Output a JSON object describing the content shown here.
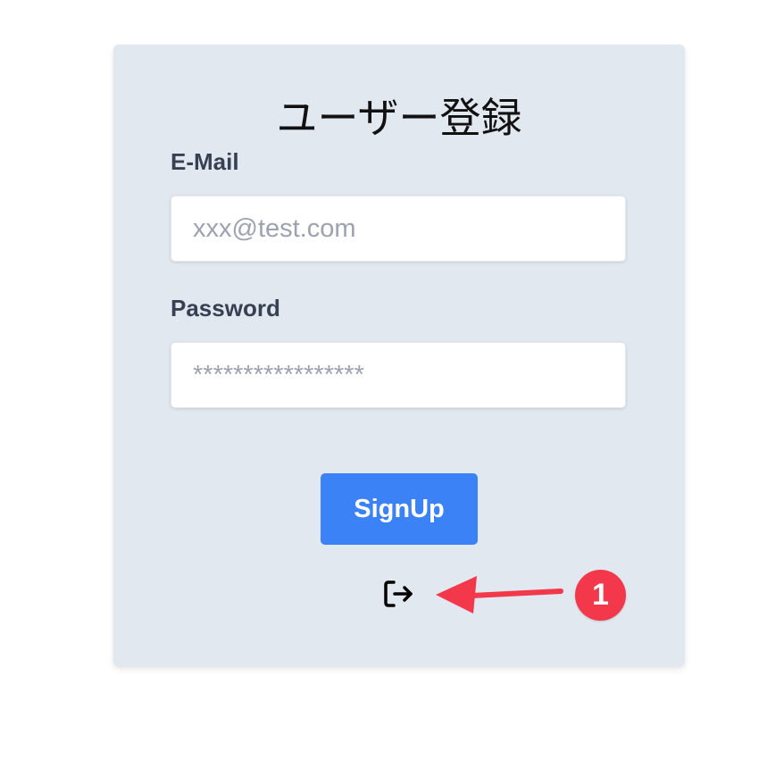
{
  "form": {
    "title": "ユーザー登録",
    "email_label": "E-Mail",
    "email_placeholder": "xxx@test.com",
    "email_value": "",
    "password_label": "Password",
    "password_placeholder": "*****************",
    "password_value": "",
    "signup_label": "SignUp",
    "signin_icon": "sign-in-icon"
  },
  "annotation": {
    "badge_number": "1",
    "color": "#f2384a"
  },
  "colors": {
    "card_background": "#e2e8f0",
    "button_primary": "#3b82f6",
    "label_text": "#374151",
    "placeholder": "#9ca3af"
  }
}
